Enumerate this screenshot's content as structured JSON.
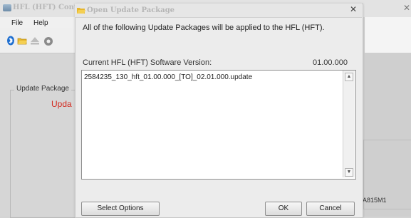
{
  "background_window": {
    "title": "HFL (HFT) Contro",
    "menu": [
      "File",
      "Help"
    ],
    "group_label": "Update Package",
    "status_text": "Upda",
    "right_id": "A815M1"
  },
  "dialog": {
    "title": "Open Update Package",
    "close_glyph": "✕",
    "message": "All of the following Update Packages will be applied to the HFL (HFT).",
    "version_label": "Current HFL (HFT) Software Version:",
    "version_value": "01.00.000",
    "packages": [
      "2584235_130_hft_01.00.000_[TO]_02.01.000.update"
    ],
    "buttons": {
      "select_options": "Select Options",
      "ok": "OK",
      "cancel": "Cancel"
    }
  },
  "colors": {
    "status_red": "#d32a1f",
    "dialog_bg": "#ececec"
  },
  "icons": [
    "bluetooth-icon",
    "folder-icon",
    "eject-icon",
    "gear-icon"
  ]
}
